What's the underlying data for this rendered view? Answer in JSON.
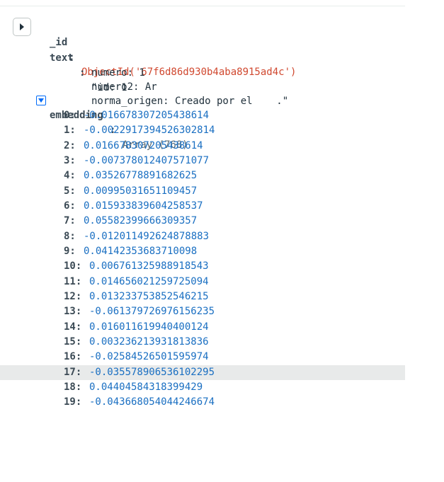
{
  "document": {
    "id_key": "_id",
    "id_value": "ObjectId('67f6d86d930b4aba8915ad4c')",
    "text_key": "text",
    "text_lines": [
      "\"id: 1",
      "numero: 1",
      "numero2: Ar",
      "norma_origen: Creado por el    .\""
    ],
    "embedding_key": "embedding",
    "embedding_type": "Array (768)",
    "embedding": [
      {
        "index": "0:",
        "value": "-0.016678307205438614"
      },
      {
        "index": "1:",
        "value": "-0.0022917394526302814"
      },
      {
        "index": "2:",
        "value": "0.016678307205438614"
      },
      {
        "index": "3:",
        "value": "-0.007378012407571077"
      },
      {
        "index": "4:",
        "value": "0.03526778891682625"
      },
      {
        "index": "5:",
        "value": "0.00995031651109457"
      },
      {
        "index": "6:",
        "value": "0.015933839604258537"
      },
      {
        "index": "7:",
        "value": "0.05582399666309357"
      },
      {
        "index": "8:",
        "value": "-0.012011492624878883"
      },
      {
        "index": "9:",
        "value": "0.04142353683710098"
      },
      {
        "index": "10:",
        "value": "0.006761325988918543"
      },
      {
        "index": "11:",
        "value": "0.014656021259725094"
      },
      {
        "index": "12:",
        "value": "0.013233753852546215"
      },
      {
        "index": "13:",
        "value": "-0.061379726976156235"
      },
      {
        "index": "14:",
        "value": "0.016011619940400124"
      },
      {
        "index": "15:",
        "value": "0.003236213931813836"
      },
      {
        "index": "16:",
        "value": "-0.02584526501595974"
      },
      {
        "index": "17:",
        "value": "-0.035578906536102295"
      },
      {
        "index": "18:",
        "value": "0.04404584318399429"
      },
      {
        "index": "19:",
        "value": "-0.043668054044246674"
      }
    ]
  },
  "icons": {
    "expand": "caret-right-icon",
    "collapse": "caret-down-icon"
  },
  "colors": {
    "key": "#3b4a55",
    "objectid": "#d0482f",
    "number": "#1a6fc2",
    "toggle": "#016bf8",
    "highlight": "#e8eaea"
  }
}
